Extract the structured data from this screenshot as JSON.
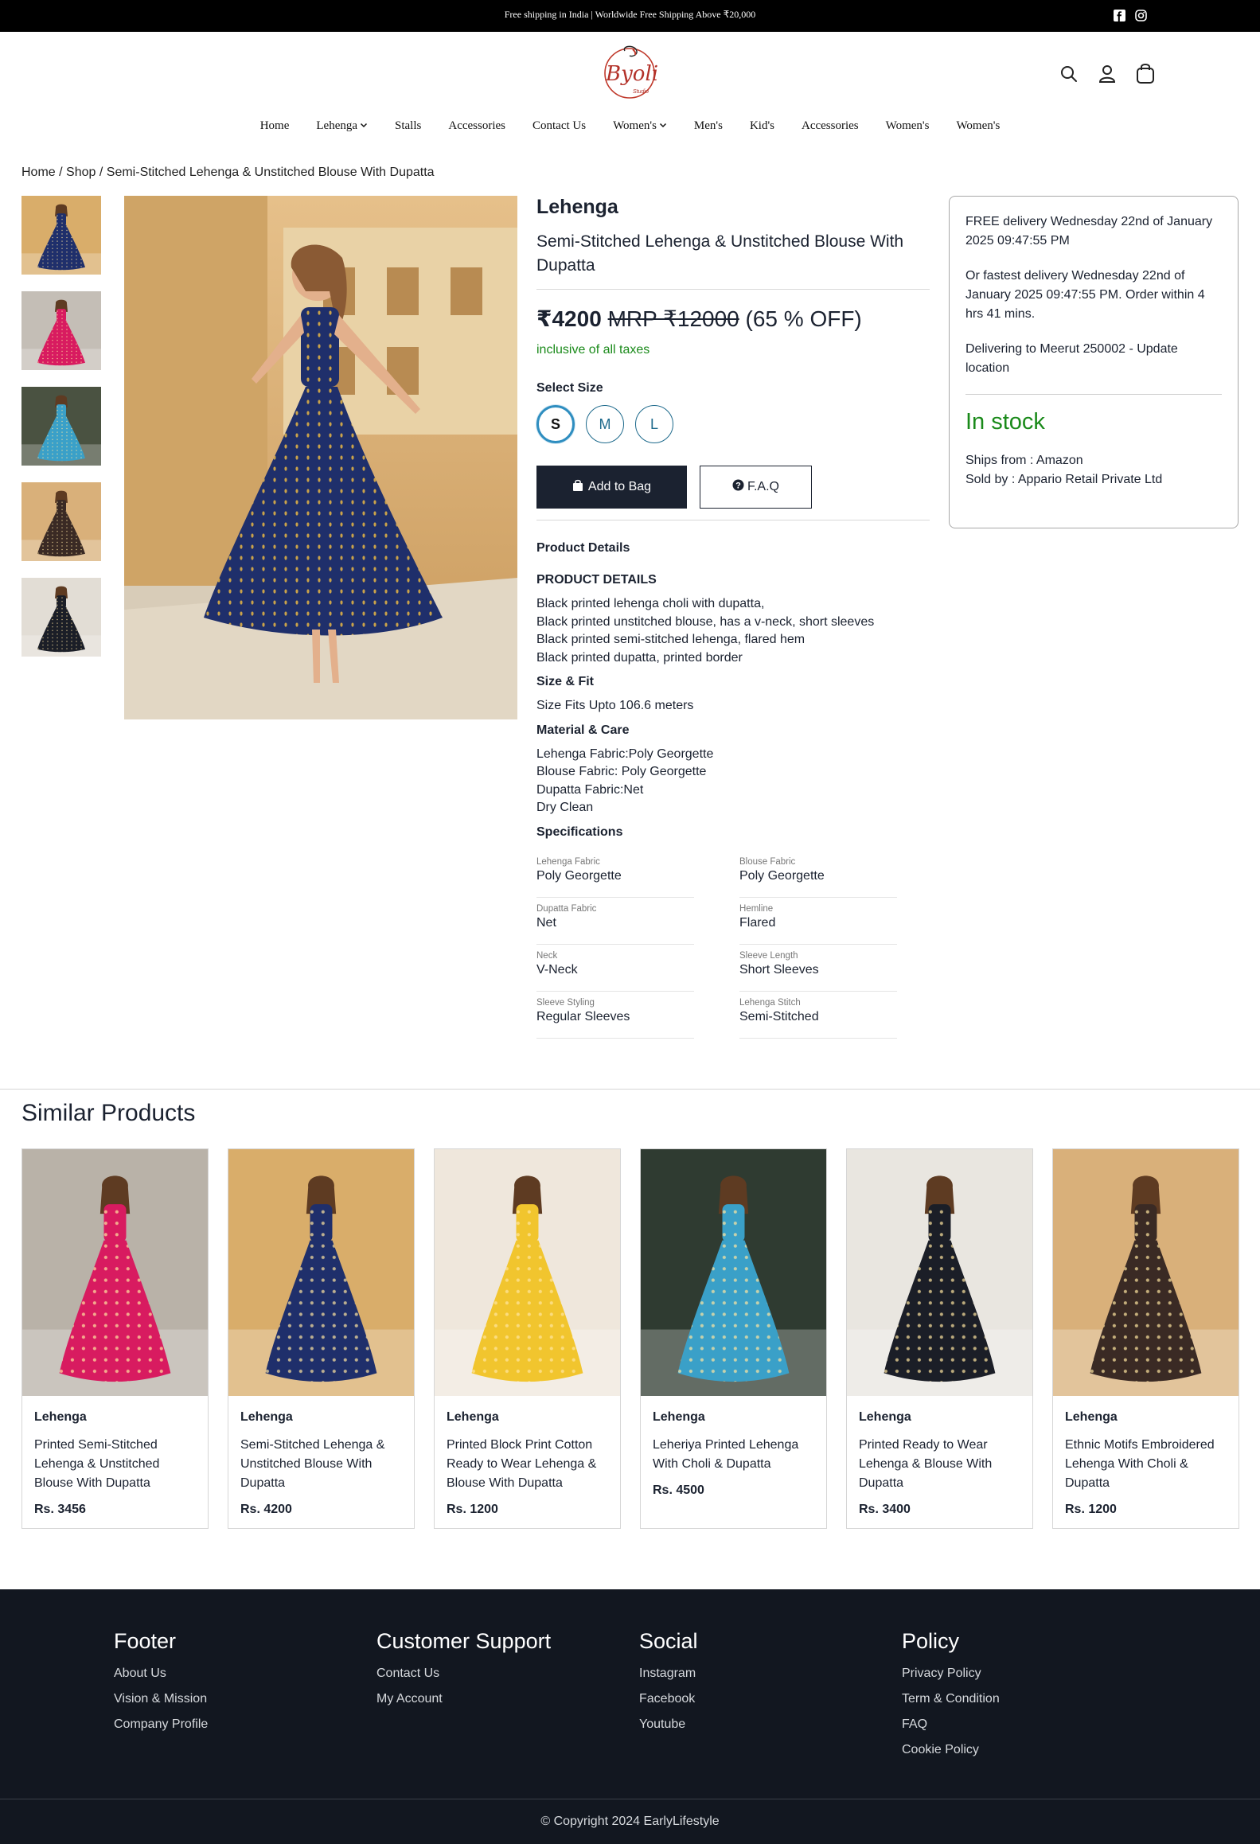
{
  "topbar": {
    "message": "Free shipping in India | Worldwide Free Shipping Above ₹20,000",
    "social": [
      "facebook-icon",
      "instagram-icon"
    ]
  },
  "brand": {
    "logo_text": "Byoli",
    "logo_sub": "Studio",
    "accent": "#c0392b"
  },
  "header_icons": [
    "search-icon",
    "user-icon",
    "bag-icon"
  ],
  "nav": {
    "items": [
      {
        "label": "Home",
        "has_dropdown": false
      },
      {
        "label": "Lehenga",
        "has_dropdown": true
      },
      {
        "label": "Stalls",
        "has_dropdown": false
      },
      {
        "label": "Accessories",
        "has_dropdown": false
      },
      {
        "label": "Contact Us",
        "has_dropdown": false
      },
      {
        "label": "Women's",
        "has_dropdown": true
      },
      {
        "label": "Men's",
        "has_dropdown": false
      },
      {
        "label": "Kid's",
        "has_dropdown": false
      },
      {
        "label": "Accessories",
        "has_dropdown": false
      },
      {
        "label": "Women's",
        "has_dropdown": false
      },
      {
        "label": "Women's",
        "has_dropdown": false
      }
    ]
  },
  "breadcrumb": {
    "home": "Home",
    "shop": "Shop",
    "current": "Semi-Stitched Lehenga & Unstitched Blouse With Dupatta",
    "sep": "/"
  },
  "product": {
    "category": "Lehenga",
    "title": "Semi-Stitched Lehenga & Unstitched Blouse With Dupatta",
    "price": "₹4200",
    "mrp": "MRP ₹12000",
    "discount": "(65 % OFF)",
    "taxes": "inclusive of all taxes",
    "select_size_label": "Select Size",
    "sizes": [
      "S",
      "M",
      "L"
    ],
    "selected_size": "S",
    "add_to_bag": "Add to Bag",
    "faq": "F.A.Q",
    "details_heading": "Product Details",
    "details_subheading": "PRODUCT DETAILS",
    "details_lines": [
      "Black printed lehenga choli with dupatta,",
      "Black printed unstitched blouse, has a v-neck, short sleeves",
      "Black printed semi-stitched lehenga, flared hem",
      "Black printed dupatta, printed border"
    ],
    "size_fit_heading": "Size & Fit",
    "size_fit_text": "Size Fits Upto 106.6 meters",
    "material_heading": "Material & Care",
    "material_lines": [
      "Lehenga Fabric:Poly Georgette",
      "Blouse Fabric: Poly Georgette",
      "Dupatta Fabric:Net",
      "Dry Clean"
    ],
    "specs_heading": "Specifications",
    "specs": [
      {
        "key": "Lehenga Fabric",
        "value": "Poly Georgette"
      },
      {
        "key": "Blouse Fabric",
        "value": "Poly Georgette"
      },
      {
        "key": "Dupatta Fabric",
        "value": "Net"
      },
      {
        "key": "Hemline",
        "value": "Flared"
      },
      {
        "key": "Neck",
        "value": "V-Neck"
      },
      {
        "key": "Sleeve Length",
        "value": "Short Sleeves"
      },
      {
        "key": "Sleeve Styling",
        "value": "Regular Sleeves"
      },
      {
        "key": "Lehenga Stitch",
        "value": "Semi-Stitched"
      }
    ]
  },
  "delivery": {
    "free_delivery": "FREE delivery Wednesday 22nd of January 2025 09:47:55 PM",
    "fastest_delivery": "Or fastest delivery Wednesday 22nd of January 2025 09:47:55 PM. Order within 4 hrs 41 mins.",
    "location": "Delivering to Meerut 250002 - Update location",
    "stock": "In stock",
    "ships_from": "Ships from : Amazon",
    "sold_by": "Sold by : Appario Retail Private Ltd",
    "stock_color": "#1a8a1a"
  },
  "similar": {
    "title": "Similar Products",
    "items": [
      {
        "category": "Lehenga",
        "name": "Printed Semi-Stitched Lehenga & Unstitched Blouse With Dupatta",
        "price": "Rs. 3456",
        "dress": "#d81b60",
        "bg": "#b9b2a8"
      },
      {
        "category": "Lehenga",
        "name": "Semi-Stitched Lehenga & Unstitched Blouse With Dupatta",
        "price": "Rs. 4200",
        "dress": "#1f2f6b",
        "bg": "#d9ad6a"
      },
      {
        "category": "Lehenga",
        "name": "Printed Block Print Cotton Ready to Wear Lehenga & Blouse With Dupatta",
        "price": "Rs. 1200",
        "dress": "#f1c52e",
        "bg": "#efe7dc"
      },
      {
        "category": "Lehenga",
        "name": "Leheriya Printed Lehenga With Choli & Dupatta",
        "price": "Rs. 4500",
        "dress": "#3aa0c8",
        "bg": "#2f3b31"
      },
      {
        "category": "Lehenga",
        "name": "Printed Ready to Wear Lehenga & Blouse With Dupatta",
        "price": "Rs. 3400",
        "dress": "#1b1e27",
        "bg": "#e9e6e0"
      },
      {
        "category": "Lehenga",
        "name": "Ethnic Motifs Embroidered Lehenga With Choli & Dupatta",
        "price": "Rs. 1200",
        "dress": "#3a2a24",
        "bg": "#d9b07a"
      }
    ]
  },
  "thumbnails": [
    {
      "dress": "#1f2f6b",
      "bg": "#d9ad6a"
    },
    {
      "dress": "#d81b60",
      "bg": "#c4beb6"
    },
    {
      "dress": "#3aa0c8",
      "bg": "#4a5241"
    },
    {
      "dress": "#3a2a24",
      "bg": "#d9b07a"
    },
    {
      "dress": "#1b1e27",
      "bg": "#e2ddd5"
    }
  ],
  "footer": {
    "columns": [
      {
        "title": "Footer",
        "links": [
          "About Us",
          "Vision & Mission",
          "Company Profile"
        ]
      },
      {
        "title": "Customer Support",
        "links": [
          "Contact Us",
          "My Account"
        ]
      },
      {
        "title": "Social",
        "links": [
          "Instagram",
          "Facebook",
          "Youtube"
        ]
      },
      {
        "title": "Policy",
        "links": [
          "Privacy Policy",
          "Term & Condition",
          "FAQ",
          "Cookie Policy"
        ]
      }
    ],
    "copyright": "© Copyright 2024 EarlyLifestyle"
  }
}
